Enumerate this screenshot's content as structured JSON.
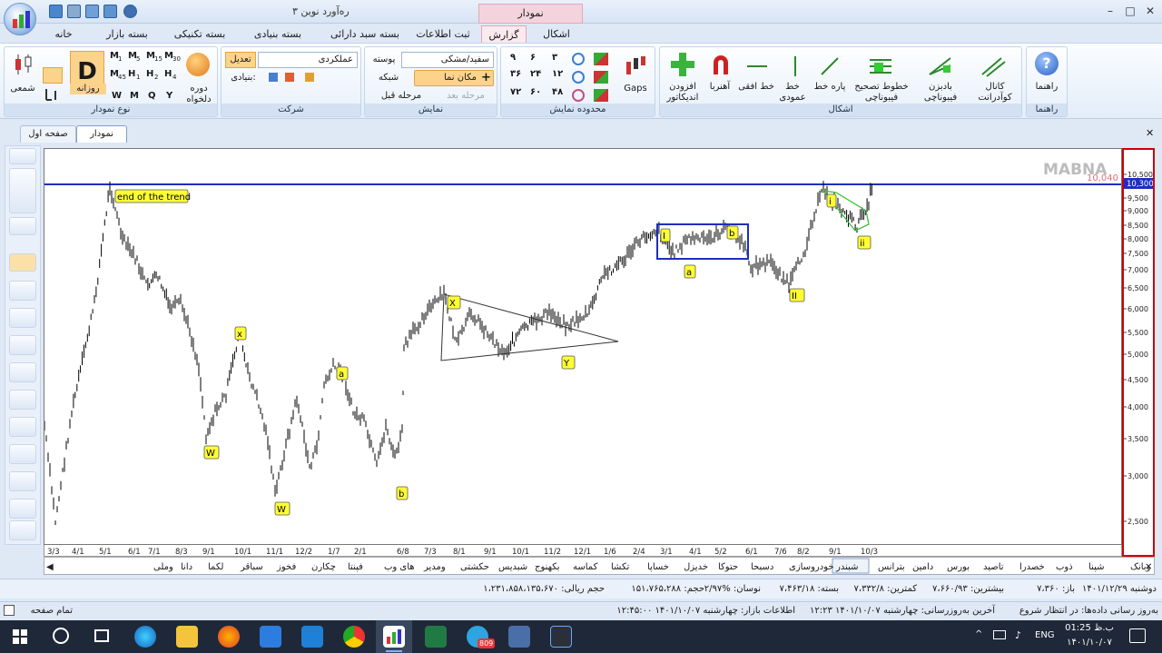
{
  "window": {
    "title": "ره‌آورد نوین ۳",
    "context_tab_title": "نمودار",
    "minimize": "–",
    "maximize": "□",
    "close": "✕"
  },
  "menu": {
    "tabs": [
      "خانه",
      "بسته بازار",
      "بسته تکنیکی",
      "بسته بنیادی",
      "بسته سبد دارائی",
      "ثبت اطلاعات",
      "گزارش",
      "اشکال"
    ],
    "active": "گزارش"
  },
  "ribbon": {
    "groups": {
      "help": {
        "label": "راهنما",
        "button": "راهنما"
      },
      "shapes": {
        "label": "اشکال",
        "buttons": [
          "کانال کوآدرانت",
          "بادبزن فیبوناچی",
          "خطوط تصحیح فیبوناچی",
          "پاره خط",
          "خط عمودی",
          "خط افقی",
          "آهنربا",
          "افزودن اندیکاتور"
        ]
      },
      "range": {
        "label": "محدوده نمایش",
        "numbers": [
          "۳",
          "۶",
          "۹",
          "۱۲",
          "۲۴",
          "۳۶",
          "۴۸",
          "۶۰",
          "۷۲"
        ],
        "gaps": "Gaps"
      },
      "display": {
        "label": "نمایش",
        "skin_label": "پوسته",
        "skin_value": "سفید/مشکی",
        "grid": "شبکه",
        "cursor": "مکان نما",
        "prev_step": "مرحله قبل",
        "next_step": "مرحله بعد"
      },
      "company": {
        "label": "شرکت",
        "value": "عملکردی",
        "adjust": "تعدیل",
        "fundamental": "بنیادی:"
      },
      "chart_type": {
        "label": "نوع نمودار",
        "candle": "شمعی",
        "daily": "روزانه",
        "custom": "دوره دلخواه",
        "letter_D": "D",
        "periods": [
          "W",
          "M",
          "Q",
          "Y"
        ],
        "minutes": [
          "1",
          "5",
          "15",
          "30",
          "45",
          "1",
          "2",
          "4"
        ],
        "minute_letters": [
          "M",
          "M",
          "M",
          "M",
          "M",
          "H",
          "H",
          "H"
        ]
      }
    }
  },
  "doc_tabs": [
    "نمودار",
    "صفحه اول"
  ],
  "chart": {
    "watermark": "MABNA",
    "current_price_label": "10,300",
    "last_label": "10,040",
    "yticks": [
      "10,500",
      "9,500",
      "9,000",
      "8,500",
      "8,000",
      "7,500",
      "7,000",
      "6,500",
      "6,000",
      "5,500",
      "5,000",
      "4,500",
      "4,000",
      "3,500",
      "3,000",
      "2,500"
    ],
    "xticks": [
      "3/3",
      "4/1",
      "5/1",
      "6/1",
      "7/1",
      "8/3",
      "9/1",
      "10/1",
      "11/1",
      "12/2",
      "1/7",
      "2/1",
      "6/8",
      "7/3",
      "8/1",
      "9/1",
      "10/1",
      "11/2",
      "12/1",
      "1/6",
      "2/4",
      "3/1",
      "4/1",
      "5/2",
      "6/1",
      "7/6",
      "8/2",
      "9/1",
      "10/3"
    ],
    "annotations": [
      "end of the trend",
      "x",
      "W",
      "W",
      "a",
      "b",
      "X",
      "Y",
      "I",
      "a",
      "b",
      "II",
      "i",
      "ii"
    ],
    "colors": {
      "price": "#000000",
      "hline": "#1d2fbf",
      "box": "#1d2fbf",
      "triangle": "#333333",
      "wedge": "#3bbf3b",
      "label_bg": "#ffff33",
      "accent": "#d10000"
    }
  },
  "symbols": [
    "وبانک",
    "شپنا",
    "ذوب",
    "خصدرا",
    "تاصید",
    "بورس",
    "دامین",
    "بترانس",
    "شبندر",
    "خودروسازی",
    "دسبحا",
    "حتوکا",
    "خدیزل",
    "خساپا",
    "تکشا",
    "کماسه",
    "بکهنوج",
    "شبدیس",
    "حکشتی",
    "ومدیر",
    "های وب",
    "فپنتا",
    "چکارن",
    "فخوز",
    "سباقر",
    "لکما",
    "دانا",
    "وملی"
  ],
  "active_symbol": "شبندر",
  "status": {
    "date": "دوشنبه ۱۴۰۱/۱۲/۲۹",
    "open": "باز: ۷،۳۶۰",
    "high": "بیشترین: ۷،۶۶۰/۹۳",
    "low": "کمترین: ۷،۳۳۲/۸",
    "close": "بسته: ۷،۴۶۳/۱۸",
    "range": "نوسان: %۲/۹۷",
    "volume": "حجم: ۱۵۱،۷۶۵،۲۸۸",
    "value": "حجم ریالی: ۱،۲۳۱،۸۵۸،۱۳۵،۶۷۰"
  },
  "status2": {
    "update": "به‌روز رسانی داده‌ها: در انتظار شروع",
    "last_update": "آخرین به‌روزرسانی: چهارشنبه ۱۴۰۱/۱۰/۰۷ ۱۲:۲۳",
    "market": "اطلاعات بازار: چهارشنبه ۱۴۰۱/۱۰/۰۷ ۱۲:۴۵:۰۰",
    "fullscreen": "تمام صفحه"
  },
  "taskbar": {
    "lang": "ENG",
    "time": "01:25 ب.ظ",
    "date": "۱۴۰۱/۱۰/۰۷",
    "badge": "809"
  }
}
